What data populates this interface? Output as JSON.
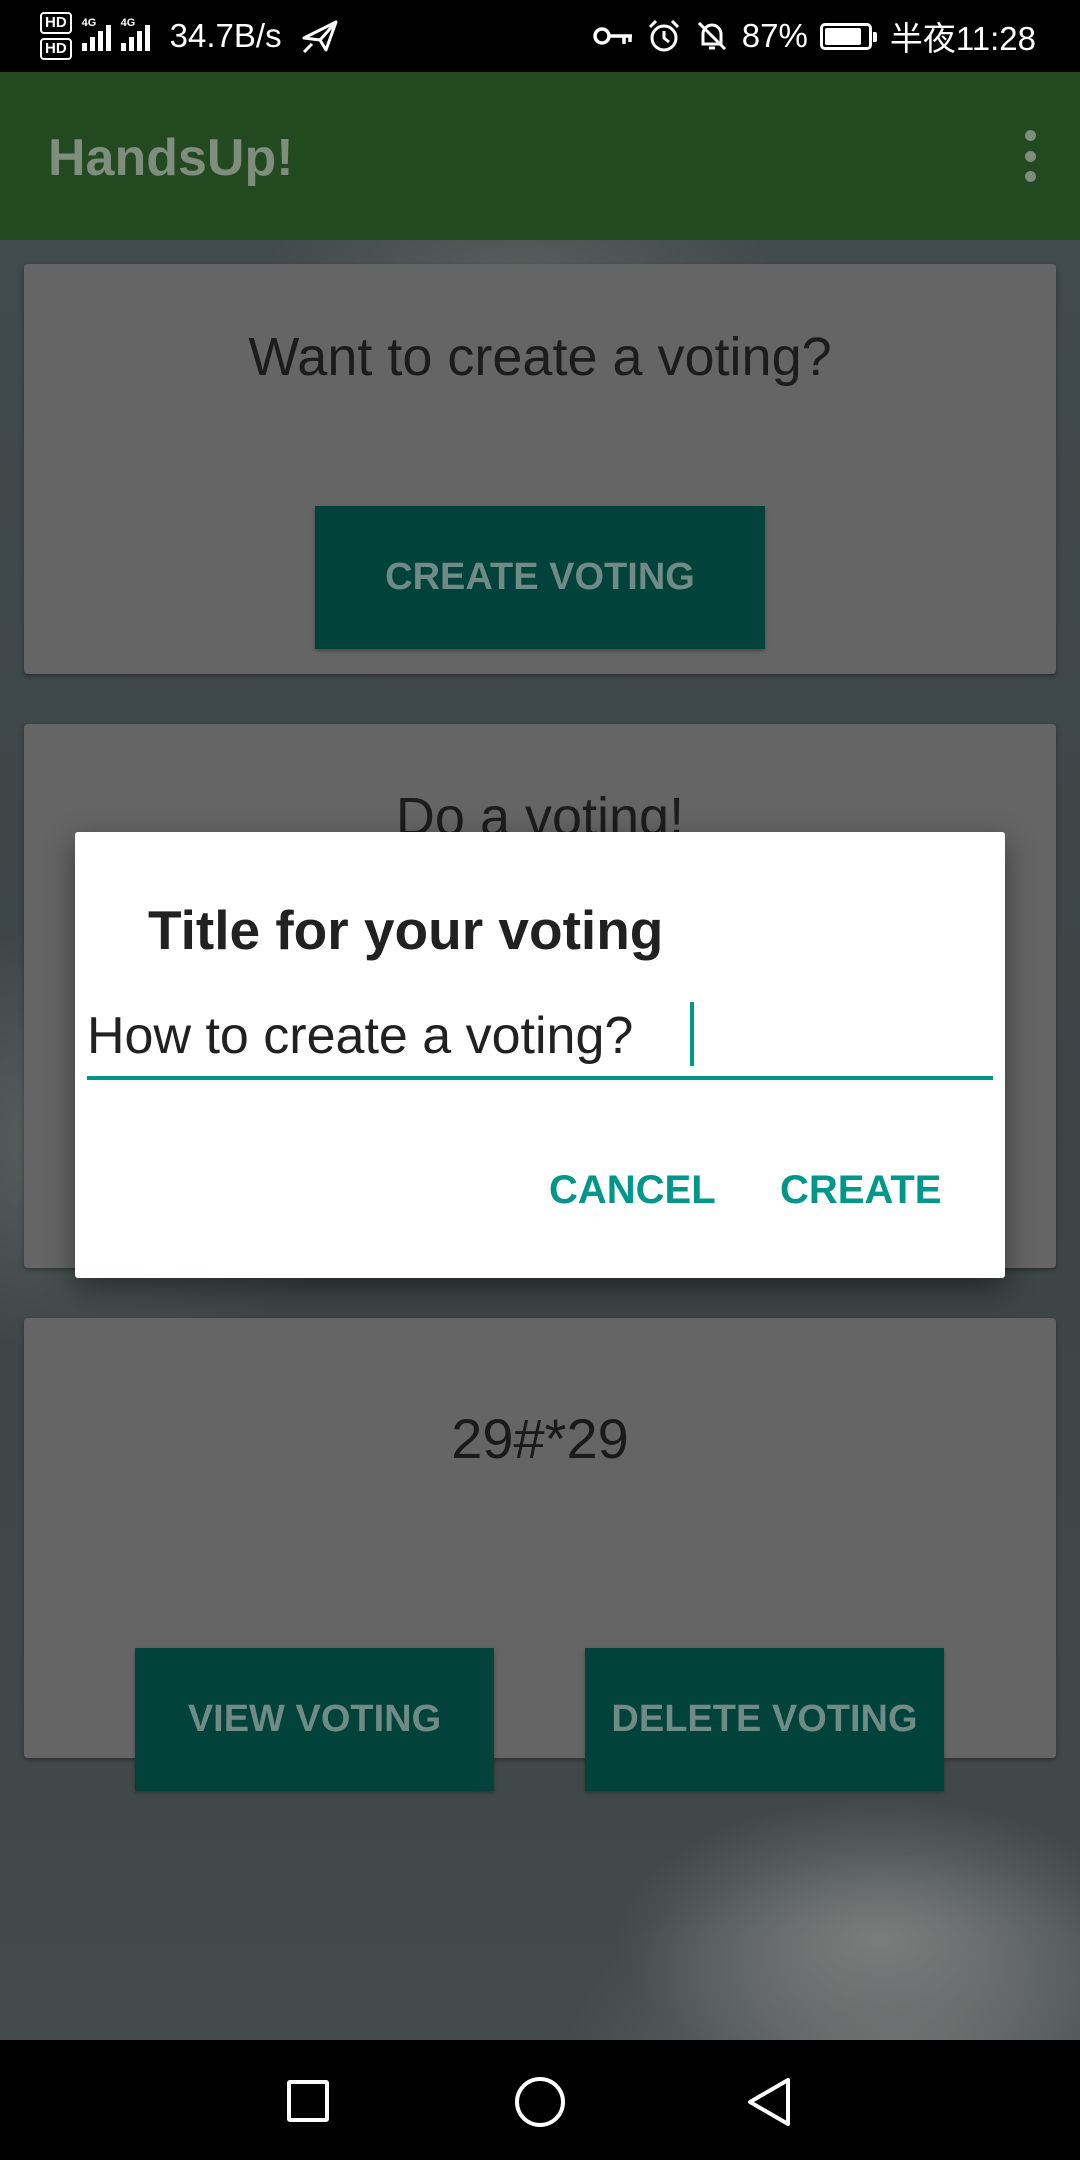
{
  "status_bar": {
    "hd1": "HD",
    "hd2": "HD",
    "net1": "4G",
    "net2": "4G",
    "speed": "34.7B/s",
    "battery": "87%",
    "battery_level": 0.87,
    "time": "半夜11:28",
    "icons": [
      "hd-icon",
      "signal-icon",
      "airplane-icon",
      "key-icon",
      "alarm-icon",
      "mute-icon",
      "battery-icon"
    ]
  },
  "app_bar": {
    "title": "HandsUp!",
    "overflow_icon": "more-vert-icon"
  },
  "cards": {
    "create": {
      "title": "Want to create a voting?",
      "button": "CREATE VOTING"
    },
    "do": {
      "title": "Do a voting!"
    },
    "existing": {
      "code": "29#*29",
      "view_button": "VIEW VOTING",
      "delete_button": "DELETE VOTING"
    }
  },
  "dialog": {
    "title": "Title for your voting",
    "input_value": "How to create a voting?",
    "cancel": "CANCEL",
    "create": "CREATE"
  },
  "colors": {
    "app_bar": "#22491f",
    "accent": "#00968a",
    "button": "#01423a"
  },
  "nav_bar": {
    "icons": [
      "recents-icon",
      "home-icon",
      "back-icon"
    ]
  }
}
